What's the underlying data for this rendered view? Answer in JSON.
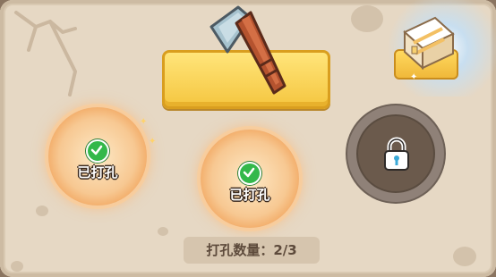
{
  "holes": [
    {
      "label": "已打孔",
      "state": "drilled"
    },
    {
      "label": "已打孔",
      "state": "drilled"
    },
    {
      "state": "locked"
    }
  ],
  "count": {
    "text": "打孔数量：2/3",
    "current": 2,
    "total": 3
  },
  "icons": {
    "drill": "hammer-icon",
    "reward": "treasure-chest-icon",
    "drilled": "check-icon",
    "locked": "padlock-icon"
  },
  "colors": {
    "panel": "#e6d8c4",
    "button": "#f5c640",
    "hole_glow": "#ed8a3a",
    "check": "#33b84a",
    "locked_ring": "#8f8178"
  }
}
